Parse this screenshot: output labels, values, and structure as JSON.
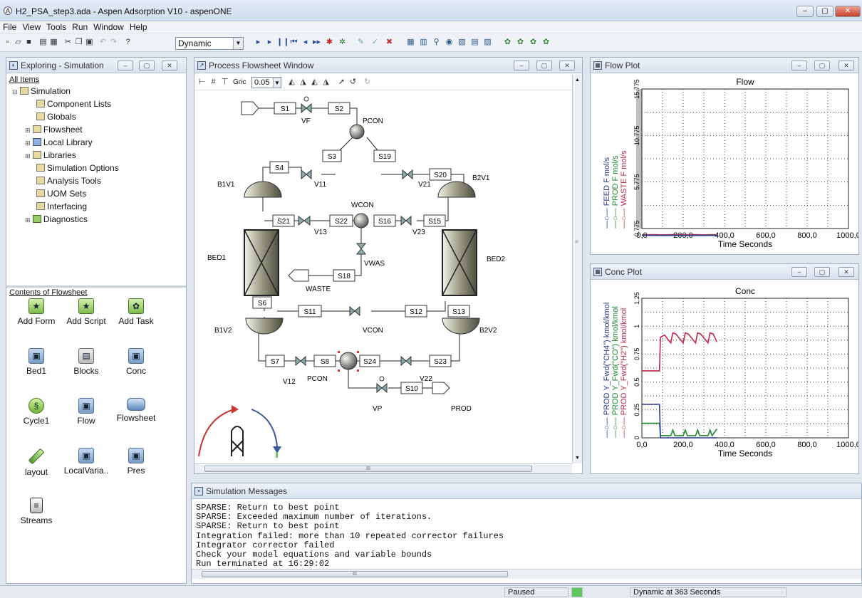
{
  "app": {
    "title": "H2_PSA_step3.ada - Aspen Adsorption V10 - aspenONE",
    "menu": [
      "File",
      "View",
      "Tools",
      "Run",
      "Window",
      "Help"
    ],
    "mode_select": "Dynamic",
    "window_buttons": {
      "minimize": "–",
      "maximize": "▢",
      "close": "✕"
    }
  },
  "explorer": {
    "title": "Exploring - Simulation",
    "all_items_label": "All Items",
    "tree": [
      {
        "label": "Simulation",
        "icon": "folder-icon",
        "expander": "⊟"
      },
      {
        "label": "Component Lists",
        "icon": "component-lists-icon",
        "expander": ""
      },
      {
        "label": "Globals",
        "icon": "globals-icon",
        "expander": ""
      },
      {
        "label": "Flowsheet",
        "icon": "flowsheet-icon",
        "expander": "⊞"
      },
      {
        "label": "Local Library",
        "icon": "library-icon",
        "expander": "⊞"
      },
      {
        "label": "Libraries",
        "icon": "libraries-icon",
        "expander": "⊞"
      },
      {
        "label": "Simulation Options",
        "icon": "options-icon",
        "expander": ""
      },
      {
        "label": "Analysis Tools",
        "icon": "tools-icon",
        "expander": ""
      },
      {
        "label": "UOM Sets",
        "icon": "uom-icon",
        "expander": ""
      },
      {
        "label": "Interfacing",
        "icon": "interfacing-icon",
        "expander": ""
      },
      {
        "label": "Diagnostics",
        "icon": "diagnostics-icon",
        "expander": "⊞"
      }
    ],
    "contents_label": "Contents of Flowsheet",
    "contents": [
      {
        "label": "Add Form",
        "icon": "add-form-icon"
      },
      {
        "label": "Add Script",
        "icon": "add-script-icon"
      },
      {
        "label": "Add Task",
        "icon": "add-task-icon"
      },
      {
        "label": "Bed1",
        "icon": "block-icon"
      },
      {
        "label": "Blocks",
        "icon": "blocks-icon"
      },
      {
        "label": "Conc",
        "icon": "block-icon"
      },
      {
        "label": "Cycle1",
        "icon": "cycle-icon"
      },
      {
        "label": "Flow",
        "icon": "block-icon"
      },
      {
        "label": "Flowsheet",
        "icon": "flowsheet-roll-icon"
      },
      {
        "label": "layout",
        "icon": "pencil-icon"
      },
      {
        "label": "LocalVaria..",
        "icon": "block-icon"
      },
      {
        "label": "Pres",
        "icon": "block-icon"
      },
      {
        "label": "Streams",
        "icon": "streams-icon"
      }
    ]
  },
  "flowsheet": {
    "title": "Process Flowsheet Window",
    "zoom_value": "0.05",
    "grid_label": "Gric",
    "streams": [
      "S1",
      "S2",
      "S3",
      "S4",
      "S19",
      "S20",
      "S21",
      "S22",
      "S16",
      "S15",
      "S18",
      "S6",
      "S11",
      "S12",
      "S13",
      "S7",
      "S8",
      "S24",
      "S23",
      "S10"
    ],
    "labels": {
      "vf": "VF",
      "pcon_top": "PCON",
      "v11": "V11",
      "v21": "V21",
      "b1v1": "B1V1",
      "b2v1": "B2V1",
      "wcon": "WCON",
      "v13": "V13",
      "v23": "V23",
      "bed1": "BED1",
      "bed2": "BED2",
      "vwas": "VWAS",
      "waste": "WASTE",
      "b1v2": "B1V2",
      "b2v2": "B2V2",
      "vcon": "VCON",
      "v12": "V12",
      "pcon_bot": "PCON",
      "v22": "V22",
      "vp": "VP",
      "prod": "PROD"
    }
  },
  "flow_plot": {
    "window_title": "Flow Plot",
    "legend": [
      {
        "label": "FEED F mol/s",
        "color": "#2b3a8f"
      },
      {
        "label": "PROD F mol/s",
        "color": "#1f8a2e"
      },
      {
        "label": "WASTE F mol/s",
        "color": "#c0294a"
      }
    ]
  },
  "conc_plot": {
    "window_title": "Conc Plot",
    "legend": [
      {
        "label": "PROD Y_Fwd(\"CH4\") kmol/kmol",
        "color": "#2b3a8f"
      },
      {
        "label": "PROD Y_Fwd(\"CO\") kmol/kmol",
        "color": "#1f8a2e"
      },
      {
        "label": "PROD Y_Fwd(\"H2\") kmol/kmol",
        "color": "#c0294a"
      }
    ]
  },
  "chart_data": [
    {
      "type": "line",
      "title": "Flow",
      "xlabel": "Time Seconds",
      "ylabel": "",
      "xlim": [
        0,
        1000
      ],
      "ylim": [
        0.775,
        15.775
      ],
      "xticks": [
        "0,0",
        "200,0",
        "400,0",
        "600,0",
        "800,0",
        "1000,0"
      ],
      "yticks": [
        "0.775",
        "5.775",
        "10.775",
        "15.775"
      ],
      "grid": true,
      "series": [
        {
          "name": "WASTE F mol/s",
          "color": "#c0294a",
          "x": [
            0,
            50,
            100,
            150,
            200,
            250,
            300,
            350,
            363
          ],
          "y": [
            0.1,
            0.12,
            0.1,
            0.12,
            0.1,
            0.12,
            0.1,
            0.12,
            0.1
          ]
        },
        {
          "name": "PROD F mol/s",
          "color": "#1f8a2e",
          "x": [
            0,
            363
          ],
          "y": [
            0.05,
            0.05
          ]
        },
        {
          "name": "FEED F mol/s",
          "color": "#2b3a8f",
          "x": [
            0,
            363
          ],
          "y": [
            0.03,
            0.03
          ]
        }
      ]
    },
    {
      "type": "line",
      "title": "Conc",
      "xlabel": "Time Seconds",
      "ylabel": "",
      "xlim": [
        0,
        1000
      ],
      "ylim": [
        0,
        1.25
      ],
      "xticks": [
        "0,0",
        "200,0",
        "400,0",
        "600,0",
        "800,0",
        "1000,0"
      ],
      "yticks": [
        "0",
        "0.25",
        "0.5",
        "0.75",
        "1",
        "1.25"
      ],
      "grid": true,
      "series": [
        {
          "name": "PROD Y_Fwd(\"H2\") kmol/kmol",
          "color": "#c0294a",
          "x": [
            0,
            85,
            90,
            110,
            140,
            150,
            165,
            200,
            210,
            225,
            260,
            270,
            285,
            320,
            330,
            345,
            363
          ],
          "y": [
            0.6,
            0.6,
            0.9,
            0.92,
            0.85,
            0.94,
            0.93,
            0.85,
            0.94,
            0.93,
            0.85,
            0.94,
            0.93,
            0.85,
            0.94,
            0.93,
            0.86
          ]
        },
        {
          "name": "PROD Y_Fwd(\"CO\") kmol/kmol",
          "color": "#1f8a2e",
          "x": [
            0,
            85,
            90,
            140,
            150,
            160,
            200,
            210,
            220,
            260,
            270,
            280,
            320,
            330,
            340,
            363
          ],
          "y": [
            0.13,
            0.13,
            0.02,
            0.02,
            0.07,
            0.02,
            0.02,
            0.07,
            0.02,
            0.02,
            0.07,
            0.02,
            0.02,
            0.07,
            0.02,
            0.08
          ]
        },
        {
          "name": "PROD Y_Fwd(\"CH4\") kmol/kmol",
          "color": "#2b3a8f",
          "x": [
            0,
            85,
            90,
            363
          ],
          "y": [
            0.3,
            0.3,
            0.0,
            0.0
          ]
        }
      ]
    }
  ],
  "messages": {
    "title": "Simulation Messages",
    "lines": [
      "SPARSE: Return to best point",
      "SPARSE: Exceeded maximum number of iterations.",
      "SPARSE: Return to best point",
      "Integration failed: more than 10 repeated corrector failures",
      "Integrator corrector failed",
      "Check your model equations and variable bounds",
      "Run terminated at 16:29:02"
    ]
  },
  "status": {
    "state": "Paused",
    "run_status": "Dynamic at 363 Seconds",
    "indicator_color": "#5ec95e"
  }
}
